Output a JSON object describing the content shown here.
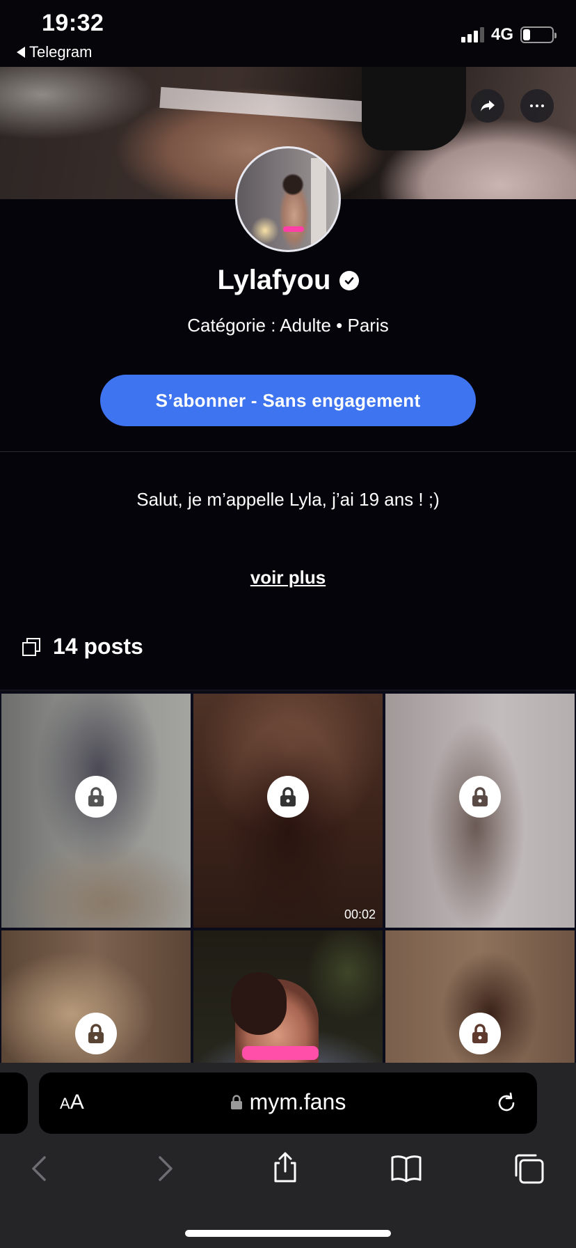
{
  "status": {
    "time": "19:32",
    "back_app": "Telegram",
    "network": "4G",
    "battery_level": 0.25
  },
  "profile": {
    "name": "Lylafyou",
    "category": "Catégorie : Adulte • Paris",
    "subscribe_label": "S’abonner - Sans engagement",
    "bio": "Salut, je m’appelle Lyla, j’ai 19 ans ! ;)",
    "see_more": "voir plus"
  },
  "posts": {
    "count_label": "14 posts",
    "items": [
      {
        "locked": true,
        "duration": ""
      },
      {
        "locked": true,
        "duration": "00:02"
      },
      {
        "locked": true,
        "duration": ""
      },
      {
        "locked": true,
        "duration": ""
      },
      {
        "locked": false,
        "duration": ""
      },
      {
        "locked": true,
        "duration": ""
      }
    ]
  },
  "browser": {
    "text_size_label": "AA",
    "url": "mym.fans"
  },
  "colors": {
    "accent": "#3f74f1",
    "background": "#04040a",
    "toolbar": "#252528"
  },
  "icons": [
    "share-icon",
    "more-icon",
    "verified-icon",
    "posts-icon",
    "lock-icon",
    "reload-icon",
    "back-icon",
    "forward-icon",
    "share-sheet-icon",
    "bookmarks-icon",
    "tabs-icon"
  ]
}
